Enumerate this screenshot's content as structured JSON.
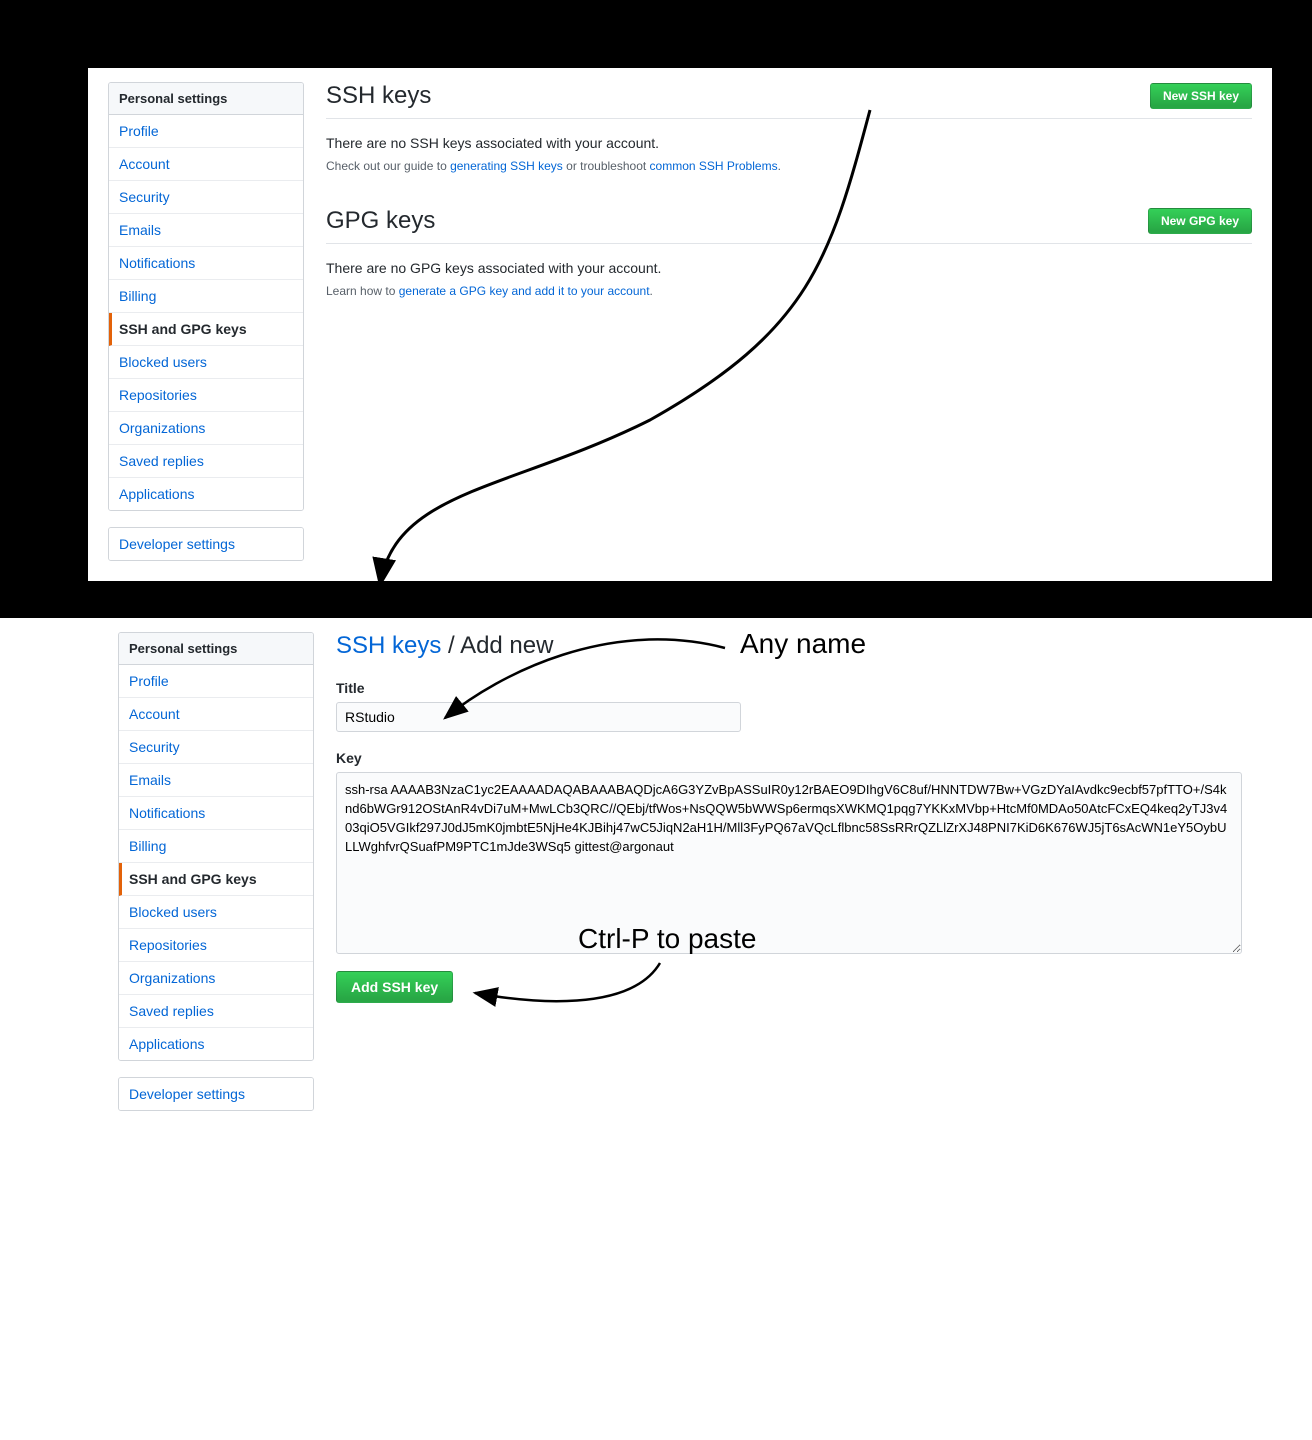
{
  "sidebar": {
    "header": "Personal settings",
    "items": [
      "Profile",
      "Account",
      "Security",
      "Emails",
      "Notifications",
      "Billing",
      "SSH and GPG keys",
      "Blocked users",
      "Repositories",
      "Organizations",
      "Saved replies",
      "Applications"
    ],
    "active_index": 6,
    "dev": "Developer settings"
  },
  "top": {
    "ssh_title": "SSH keys",
    "new_ssh_btn": "New SSH key",
    "ssh_empty": "There are no SSH keys associated with your account.",
    "ssh_help_pre": "Check out our guide to ",
    "ssh_help_link1": "generating SSH keys",
    "ssh_help_mid": " or troubleshoot ",
    "ssh_help_link2": "common SSH Problems",
    "ssh_help_post": ".",
    "gpg_title": "GPG keys",
    "new_gpg_btn": "New GPG key",
    "gpg_empty": "There are no GPG keys associated with your account.",
    "gpg_help_pre": "Learn how to ",
    "gpg_help_link": "generate a GPG key and add it to your account",
    "gpg_help_post": "."
  },
  "bottom": {
    "bc_link": "SSH keys",
    "bc_sep": " / ",
    "bc_current": "Add new",
    "title_label": "Title",
    "title_value": "RStudio",
    "key_label": "Key",
    "key_value": "ssh-rsa AAAAB3NzaC1yc2EAAAADAQABAAABAQDjcA6G3YZvBpASSuIR0y12rBAEO9DIhgV6C8uf/HNNTDW7Bw+VGzDYaIAvdkc9ecbf57pfTTO+/S4knd6bWGr912OStAnR4vDi7uM+MwLCb3QRC//QEbj/tfWos+NsQQW5bWWSp6ermqsXWKMQ1pqg7YKKxMVbp+HtcMf0MDAo50AtcFCxEQ4keq2yTJ3v403qiO5VGIkf297J0dJ5mK0jmbtE5NjHe4KJBihj47wC5JiqN2aH1H/Mll3FyPQ67aVQcLflbnc58SsRRrQZLlZrXJ48PNI7KiD6K676WJ5jT6sAcWN1eY5OybULLWghfvrQSuafPM9PTC1mJde3WSq5 gittest@argonaut",
    "add_btn": "Add SSH key"
  },
  "annotations": {
    "any_name": "Any name",
    "paste": "Ctrl-P to paste"
  }
}
